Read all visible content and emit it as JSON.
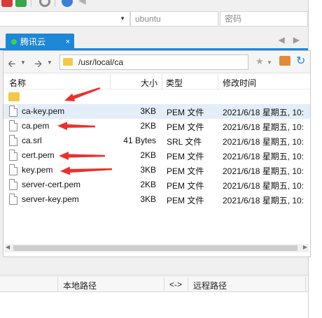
{
  "session": {
    "host_value": "",
    "username": "ubuntu",
    "password_placeholder": "密码"
  },
  "tab": {
    "label": "腾讯云",
    "close": "×"
  },
  "nav": {
    "path": "/usr/local/ca"
  },
  "columns": {
    "name": "名称",
    "size": "大小",
    "type": "类型",
    "modified": "修改时间"
  },
  "parent_dir": "..",
  "files": [
    {
      "name": "ca-key.pem",
      "size": "3KB",
      "type": "PEM 文件",
      "modified": "2021/6/18 星期五, 10:",
      "selected": true,
      "arrow": true
    },
    {
      "name": "ca.pem",
      "size": "2KB",
      "type": "PEM 文件",
      "modified": "2021/6/18 星期五, 10:",
      "arrow": true
    },
    {
      "name": "ca.srl",
      "size": "41 Bytes",
      "type": "SRL 文件",
      "modified": "2021/6/18 星期五, 10:"
    },
    {
      "name": "cert.pem",
      "size": "2KB",
      "type": "PEM 文件",
      "modified": "2021/6/18 星期五, 10:",
      "arrow": true
    },
    {
      "name": "key.pem",
      "size": "3KB",
      "type": "PEM 文件",
      "modified": "2021/6/18 星期五, 10:",
      "arrow": true
    },
    {
      "name": "server-cert.pem",
      "size": "2KB",
      "type": "PEM 文件",
      "modified": "2021/6/18 星期五, 10:"
    },
    {
      "name": "server-key.pem",
      "size": "3KB",
      "type": "PEM 文件",
      "modified": "2021/6/18 星期五, 10:"
    }
  ],
  "transfer": {
    "local_path": "本地路径",
    "direction": "<->",
    "remote_path": "远程路径"
  },
  "colors": {
    "tab_blue": "#1e87d6",
    "arrow_red": "#e8322e",
    "selected_row": "#e3eef9",
    "folder_yellow": "#f3c84b"
  },
  "icons": {
    "row_file": "file-icon",
    "row_folder": "folder-icon",
    "annotation": "red-arrow"
  }
}
